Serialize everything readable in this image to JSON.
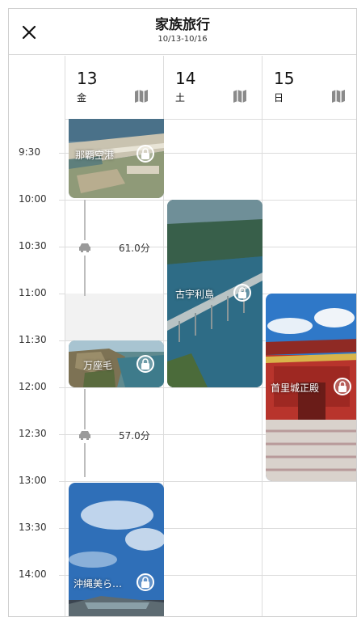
{
  "header": {
    "title": "家族旅行",
    "subtitle": "10/13-10/16",
    "close_icon": "close-icon"
  },
  "days": [
    {
      "num": "13",
      "weekday": "金"
    },
    {
      "num": "14",
      "weekday": "土"
    },
    {
      "num": "15",
      "weekday": "日"
    }
  ],
  "times": [
    "9:30",
    "10:00",
    "10:30",
    "11:00",
    "11:30",
    "12:00",
    "12:30",
    "13:00",
    "13:30",
    "14:00"
  ],
  "events": {
    "naha_airport": {
      "name": "那覇空港"
    },
    "kouri_island": {
      "name": "古宇利島"
    },
    "manzamo": {
      "name": "万座毛"
    },
    "shuri_castle": {
      "name": "首里城正殿"
    },
    "churaumi": {
      "name": "沖縄美ら…"
    }
  },
  "transits": [
    {
      "duration": "61.0分",
      "mode": "car-icon"
    },
    {
      "duration": "57.0分",
      "mode": "car-icon"
    }
  ],
  "colors": {
    "grid_line": "#dcdcdc",
    "gap_fill": "#f2f2f2"
  }
}
